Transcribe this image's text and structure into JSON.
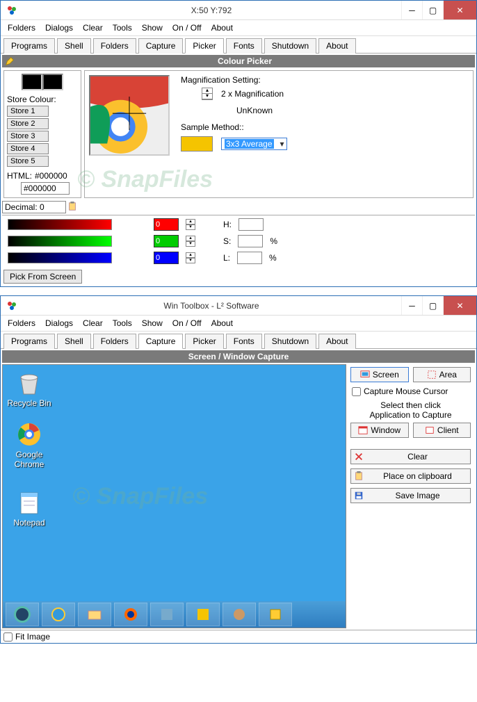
{
  "win1": {
    "title": "X:50 Y:792",
    "menu": [
      "Folders",
      "Dialogs",
      "Clear",
      "Tools",
      "Show",
      "On / Off",
      "About"
    ],
    "tabs": [
      "Programs",
      "Shell",
      "Folders",
      "Capture",
      "Picker",
      "Fonts",
      "Shutdown",
      "About"
    ],
    "active_tab": "Picker",
    "header": "Colour Picker",
    "store_label": "Store Colour:",
    "stores": [
      "Store 1",
      "Store 2",
      "Store 3",
      "Store 4",
      "Store 5"
    ],
    "html_label": "HTML:",
    "html_value": "#000000",
    "html_input": "#000000",
    "decimal": "Decimal: 0",
    "mag_label": "Magnification Setting:",
    "mag_value": "2 x Magnification",
    "mag_status": "UnKnown",
    "sample_label": "Sample Method::",
    "sample_value": "3x3 Average",
    "hsl": {
      "r": "0",
      "g": "0",
      "b": "0",
      "h_label": "H:",
      "s_label": "S:",
      "l_label": "L:",
      "pct": "%"
    },
    "pick_btn": "Pick From Screen"
  },
  "win2": {
    "title": "Win Toolbox - L² Software",
    "menu": [
      "Folders",
      "Dialogs",
      "Clear",
      "Tools",
      "Show",
      "On / Off",
      "About"
    ],
    "tabs": [
      "Programs",
      "Shell",
      "Folders",
      "Capture",
      "Picker",
      "Fonts",
      "Shutdown",
      "About"
    ],
    "active_tab": "Capture",
    "header": "Screen / Window Capture",
    "icons": {
      "recycle": "Recycle Bin",
      "chrome": "Google Chrome",
      "notepad": "Notepad"
    },
    "side": {
      "screen": "Screen",
      "area": "Area",
      "cursor_chk": "Capture Mouse Cursor",
      "select_txt1": "Select then click",
      "select_txt2": "Application to Capture",
      "window": "Window",
      "client": "Client",
      "clear": "Clear",
      "clipboard": "Place on clipboard",
      "save": "Save Image"
    },
    "fit": "Fit Image"
  }
}
